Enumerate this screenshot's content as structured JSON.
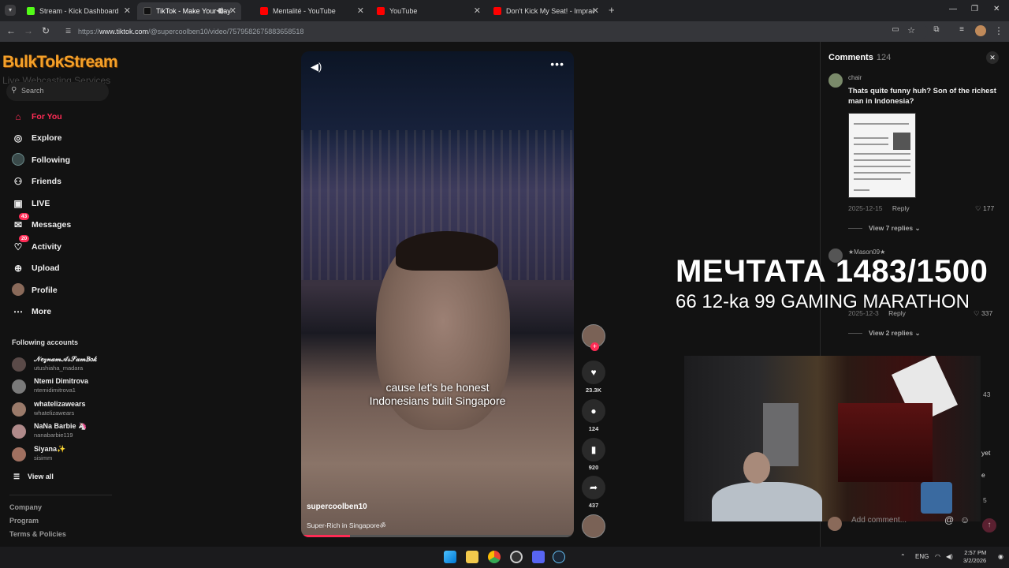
{
  "browser": {
    "tabs": [
      {
        "label": "Stream - Kick Dashboard",
        "color": "#53fc18"
      },
      {
        "label": "TikTok - Make Your Day",
        "color": "#111111"
      },
      {
        "label": "Mentalité - YouTube",
        "color": "#ff0000"
      },
      {
        "label": "YouTube",
        "color": "#ff0000"
      },
      {
        "label": "Don't Kick My Seat! - Impractic",
        "color": "#ff0000"
      }
    ],
    "url_scheme": "https://",
    "url_host": "www.tiktok.com",
    "url_path": "/@supercoolben10/video/7579582675883658518"
  },
  "sidebar": {
    "logo": "BulkTokStream",
    "logo_sub": "Live Webcasting Services",
    "search_placeholder": "Search",
    "nav": [
      {
        "label": "For You",
        "icon": "home-icon",
        "glyph": "⌂",
        "active": true
      },
      {
        "label": "Explore",
        "icon": "compass-icon",
        "glyph": "◎"
      },
      {
        "label": "Following",
        "icon": "following-icon",
        "glyph": "●"
      },
      {
        "label": "Friends",
        "icon": "friends-icon",
        "glyph": "⚇"
      },
      {
        "label": "LIVE",
        "icon": "live-icon",
        "glyph": "▣"
      },
      {
        "label": "Messages",
        "icon": "messages-icon",
        "glyph": "✉",
        "badge": "43"
      },
      {
        "label": "Activity",
        "icon": "activity-icon",
        "glyph": "♡",
        "badge": "20"
      },
      {
        "label": "Upload",
        "icon": "upload-icon",
        "glyph": "⊕"
      },
      {
        "label": "Profile",
        "icon": "profile-icon",
        "glyph": "●"
      },
      {
        "label": "More",
        "icon": "more-icon",
        "glyph": "⋯"
      }
    ],
    "following_title": "Following accounts",
    "accounts": [
      {
        "name": "𝒩𝑒𝓏𝓃𝒶𝓂𝒜𝓈𝒮𝒶𝓂𝐵𝑜𝓀",
        "user": "utushiaha_madara"
      },
      {
        "name": "Ntemi Dimitrova",
        "user": "ntemidimitrova1"
      },
      {
        "name": "whatelizawears",
        "user": "whatelizawears"
      },
      {
        "name": "NaNa Barbie 🦄",
        "user": "nanabarbie119"
      },
      {
        "name": "Siyana✨",
        "user": "sisimm"
      }
    ],
    "view_all": "View all",
    "footer": [
      "Company",
      "Program",
      "Terms & Policies"
    ]
  },
  "video": {
    "caption_line1": "cause let's be honest",
    "caption_line2": "Indonesians built Singapore",
    "author": "supercoolben10",
    "description": "Super-Rich in Singaporeॐ",
    "progress": 0.18
  },
  "actions": {
    "likes": "23.3K",
    "comments": "124",
    "saves": "920",
    "shares": "437"
  },
  "comments": {
    "title": "Comments",
    "count": "124",
    "items": [
      {
        "user": "chair",
        "text": "Thats quite funny huh? Son of the richest man in Indonesia?",
        "date": "2025-12-15",
        "reply": "Reply",
        "likes": "177",
        "view_replies": "View 7 replies"
      },
      {
        "user": "★Mason09★",
        "date": "2025-12-3",
        "reply": "Reply",
        "likes": "337",
        "view_replies": "View 2 replies"
      }
    ],
    "partial_likes": [
      "43",
      "5"
    ],
    "partial_text": [
      "yet",
      "e"
    ],
    "add_placeholder": "Add comment..."
  },
  "overlay": {
    "line1": "МЕЧТАТА 1483/1500",
    "line2": "66 12-ka 99 GAMING MARATHON"
  },
  "taskbar": {
    "lang": "ENG",
    "time": "2:57 PM",
    "date": "3/2/2026"
  }
}
